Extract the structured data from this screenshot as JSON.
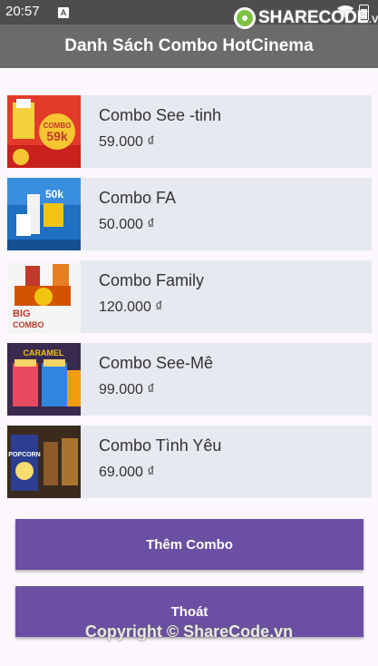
{
  "status_bar": {
    "time": "20:57",
    "notification_icon": "A"
  },
  "app_bar": {
    "title": "Danh Sách Combo HotCinema"
  },
  "watermark": {
    "brand": "SHARECODE",
    "suffix": ".vn",
    "copyright": "Copyright © ShareCode.vn"
  },
  "combos": [
    {
      "name": "Combo See -tinh",
      "price": "59.000 ₫",
      "thumb_text": "COMBO 59k"
    },
    {
      "name": "Combo FA",
      "price": "50.000 ₫",
      "thumb_text": "50k"
    },
    {
      "name": "Combo Family",
      "price": "120.000 ₫",
      "thumb_text": "BIG COMBO"
    },
    {
      "name": "Combo See-Mê",
      "price": "99.000 ₫",
      "thumb_text": "CARAMEL"
    },
    {
      "name": "Combo Tình Yêu",
      "price": "69.000 ₫",
      "thumb_text": "POPCORN"
    }
  ],
  "buttons": {
    "add": "Thêm Combo",
    "exit": "Thoát"
  }
}
